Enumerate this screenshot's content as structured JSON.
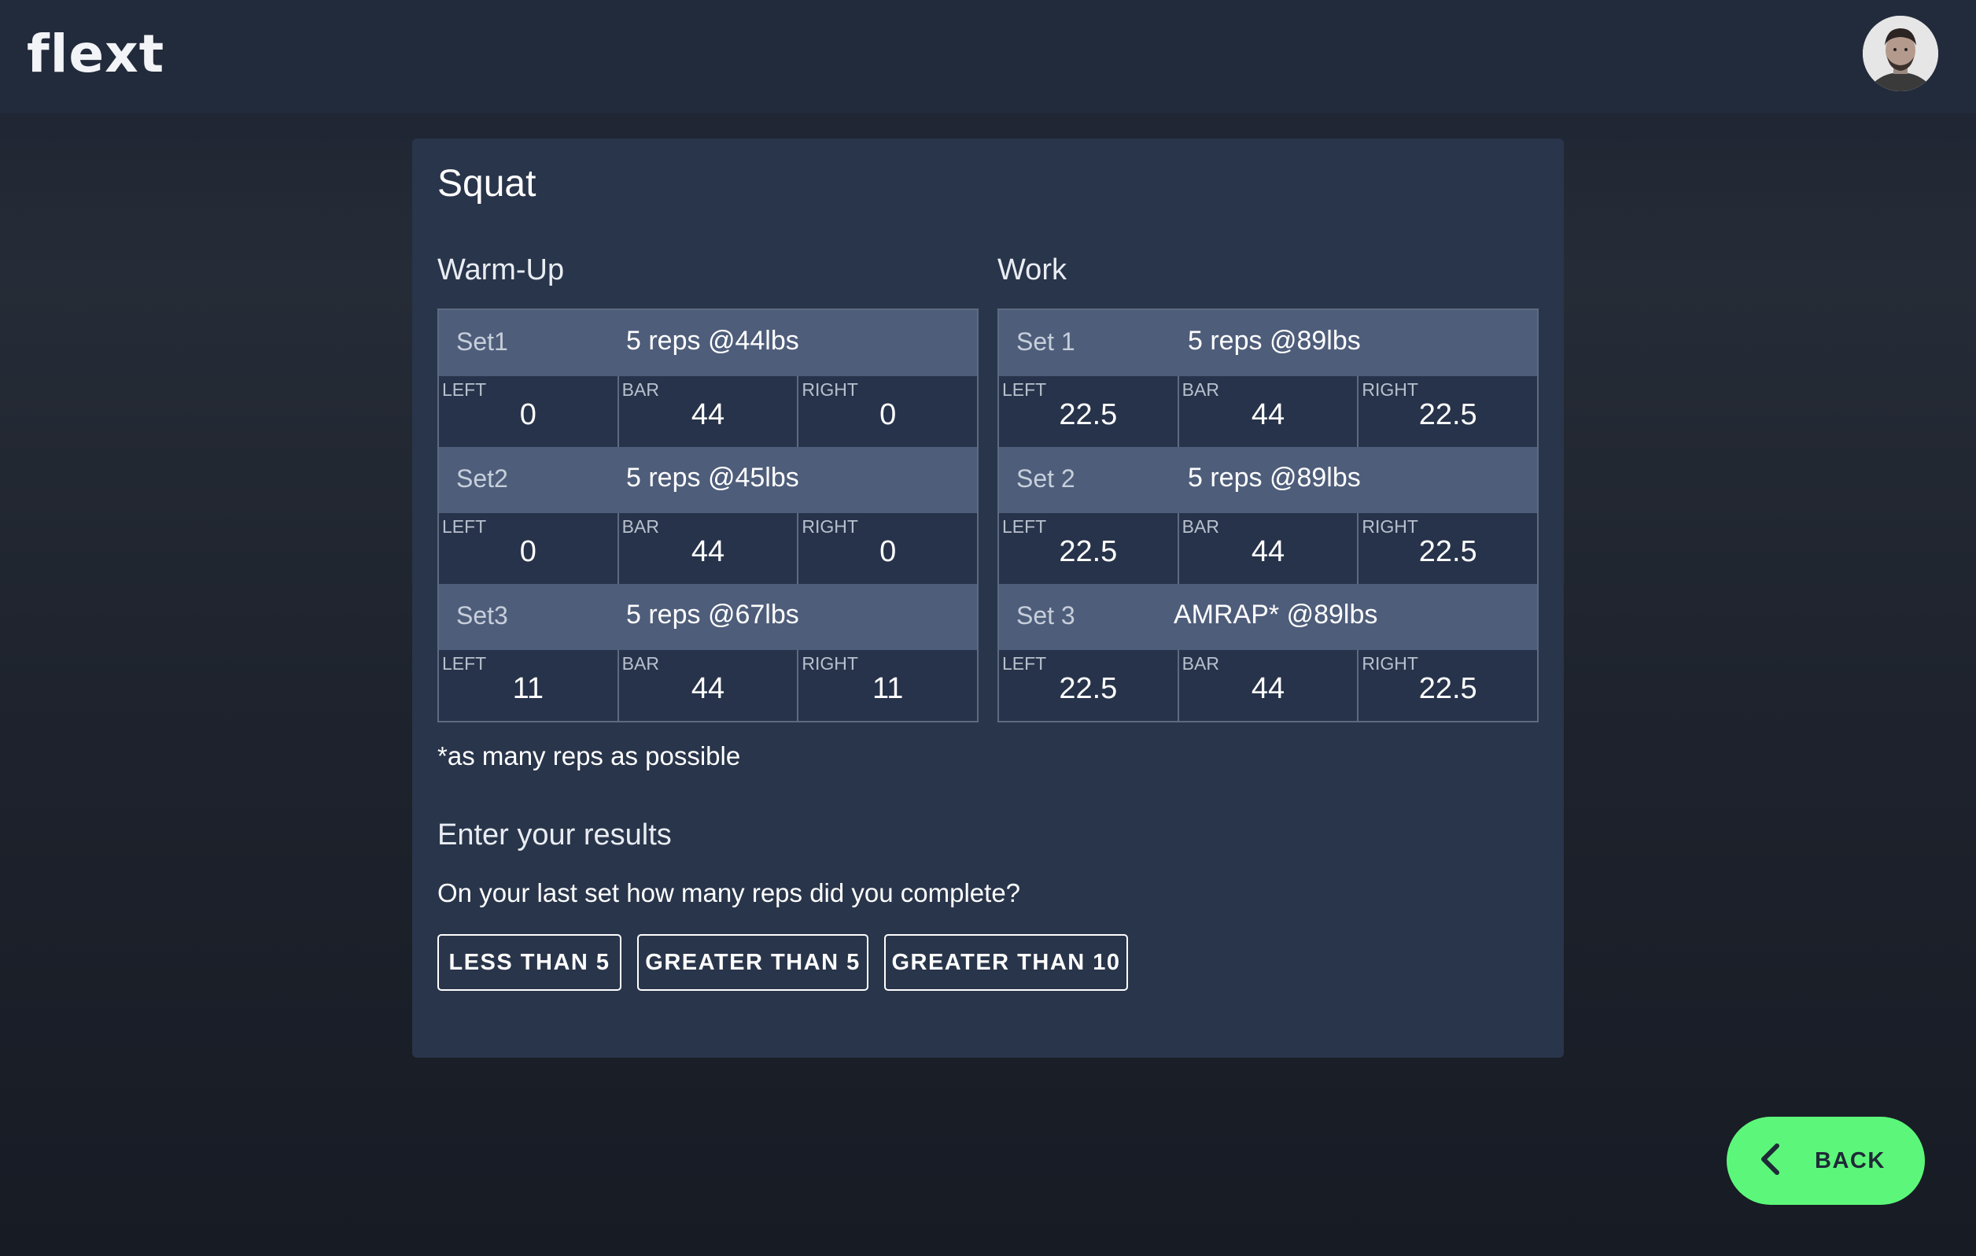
{
  "app": {
    "logo_text": "flext",
    "accent_color": "#5cf77a"
  },
  "exercise": {
    "title": "Squat",
    "warmup": {
      "title": "Warm-Up",
      "sets": [
        {
          "name": "Set1",
          "desc": "5 reps @44lbs",
          "left_label": "LEFT",
          "left": "0",
          "bar_label": "BAR",
          "bar": "44",
          "right_label": "RIGHT",
          "right": "0"
        },
        {
          "name": "Set2",
          "desc": "5 reps @45lbs",
          "left_label": "LEFT",
          "left": "0",
          "bar_label": "BAR",
          "bar": "44",
          "right_label": "RIGHT",
          "right": "0"
        },
        {
          "name": "Set3",
          "desc": "5 reps @67lbs",
          "left_label": "LEFT",
          "left": "11",
          "bar_label": "BAR",
          "bar": "44",
          "right_label": "RIGHT",
          "right": "11"
        }
      ]
    },
    "work": {
      "title": "Work",
      "sets": [
        {
          "name": "Set 1",
          "desc": "5 reps @89lbs",
          "left_label": "LEFT",
          "left": "22.5",
          "bar_label": "BAR",
          "bar": "44",
          "right_label": "RIGHT",
          "right": "22.5"
        },
        {
          "name": "Set 2",
          "desc": "5 reps @89lbs",
          "left_label": "LEFT",
          "left": "22.5",
          "bar_label": "BAR",
          "bar": "44",
          "right_label": "RIGHT",
          "right": "22.5"
        },
        {
          "name": "Set 3",
          "desc": "AMRAP* @89lbs",
          "left_label": "LEFT",
          "left": "22.5",
          "bar_label": "BAR",
          "bar": "44",
          "right_label": "RIGHT",
          "right": "22.5"
        }
      ]
    },
    "footnote": "*as many reps as possible"
  },
  "results": {
    "title": "Enter your results",
    "question": "On your last set how many reps did you complete?",
    "options": [
      "LESS THAN 5",
      "GREATER THAN 5",
      "GREATER THAN 10"
    ]
  },
  "nav": {
    "back_label": "BACK",
    "back_icon": "chevron-left-icon"
  },
  "user": {
    "avatar_icon": "user-avatar"
  }
}
